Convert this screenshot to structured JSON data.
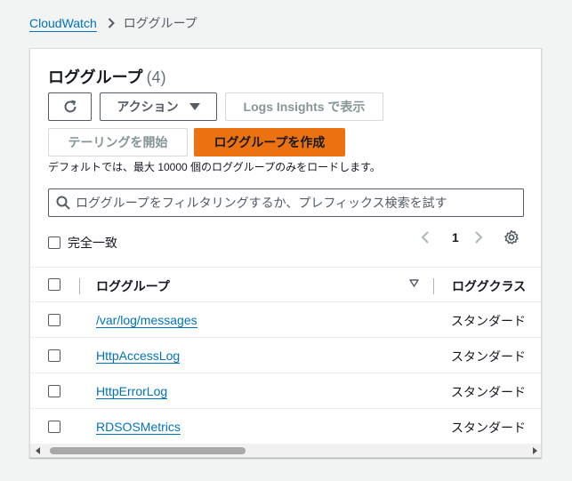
{
  "breadcrumb": {
    "root": "CloudWatch",
    "current": "ロググループ"
  },
  "panel": {
    "title": "ロググループ",
    "count": "(4)",
    "buttons": {
      "actions": "アクション",
      "insights": "Logs Insights で表示",
      "tail": "テーリングを開始",
      "create": "ロググループを作成"
    },
    "hint": "デフォルトでは、最大 10000 個のロググループのみをロードします。",
    "search": {
      "placeholder": "ロググループをフィルタリングするか、プレフィックス検索を試す",
      "value": ""
    },
    "exact_match": "完全一致",
    "page": "1"
  },
  "table": {
    "columns": {
      "name": "ロググループ",
      "class": "ロググクラス"
    },
    "rows": [
      {
        "name": "/var/log/messages",
        "class": "スタンダード"
      },
      {
        "name": "HttpAccessLog",
        "class": "スタンダード"
      },
      {
        "name": "HttpErrorLog",
        "class": "スタンダード"
      },
      {
        "name": "RDSOSMetrics",
        "class": "スタンダード"
      }
    ]
  },
  "colors": {
    "link": "#0073bb",
    "primary": "#ec7211",
    "border": "#545b64"
  }
}
